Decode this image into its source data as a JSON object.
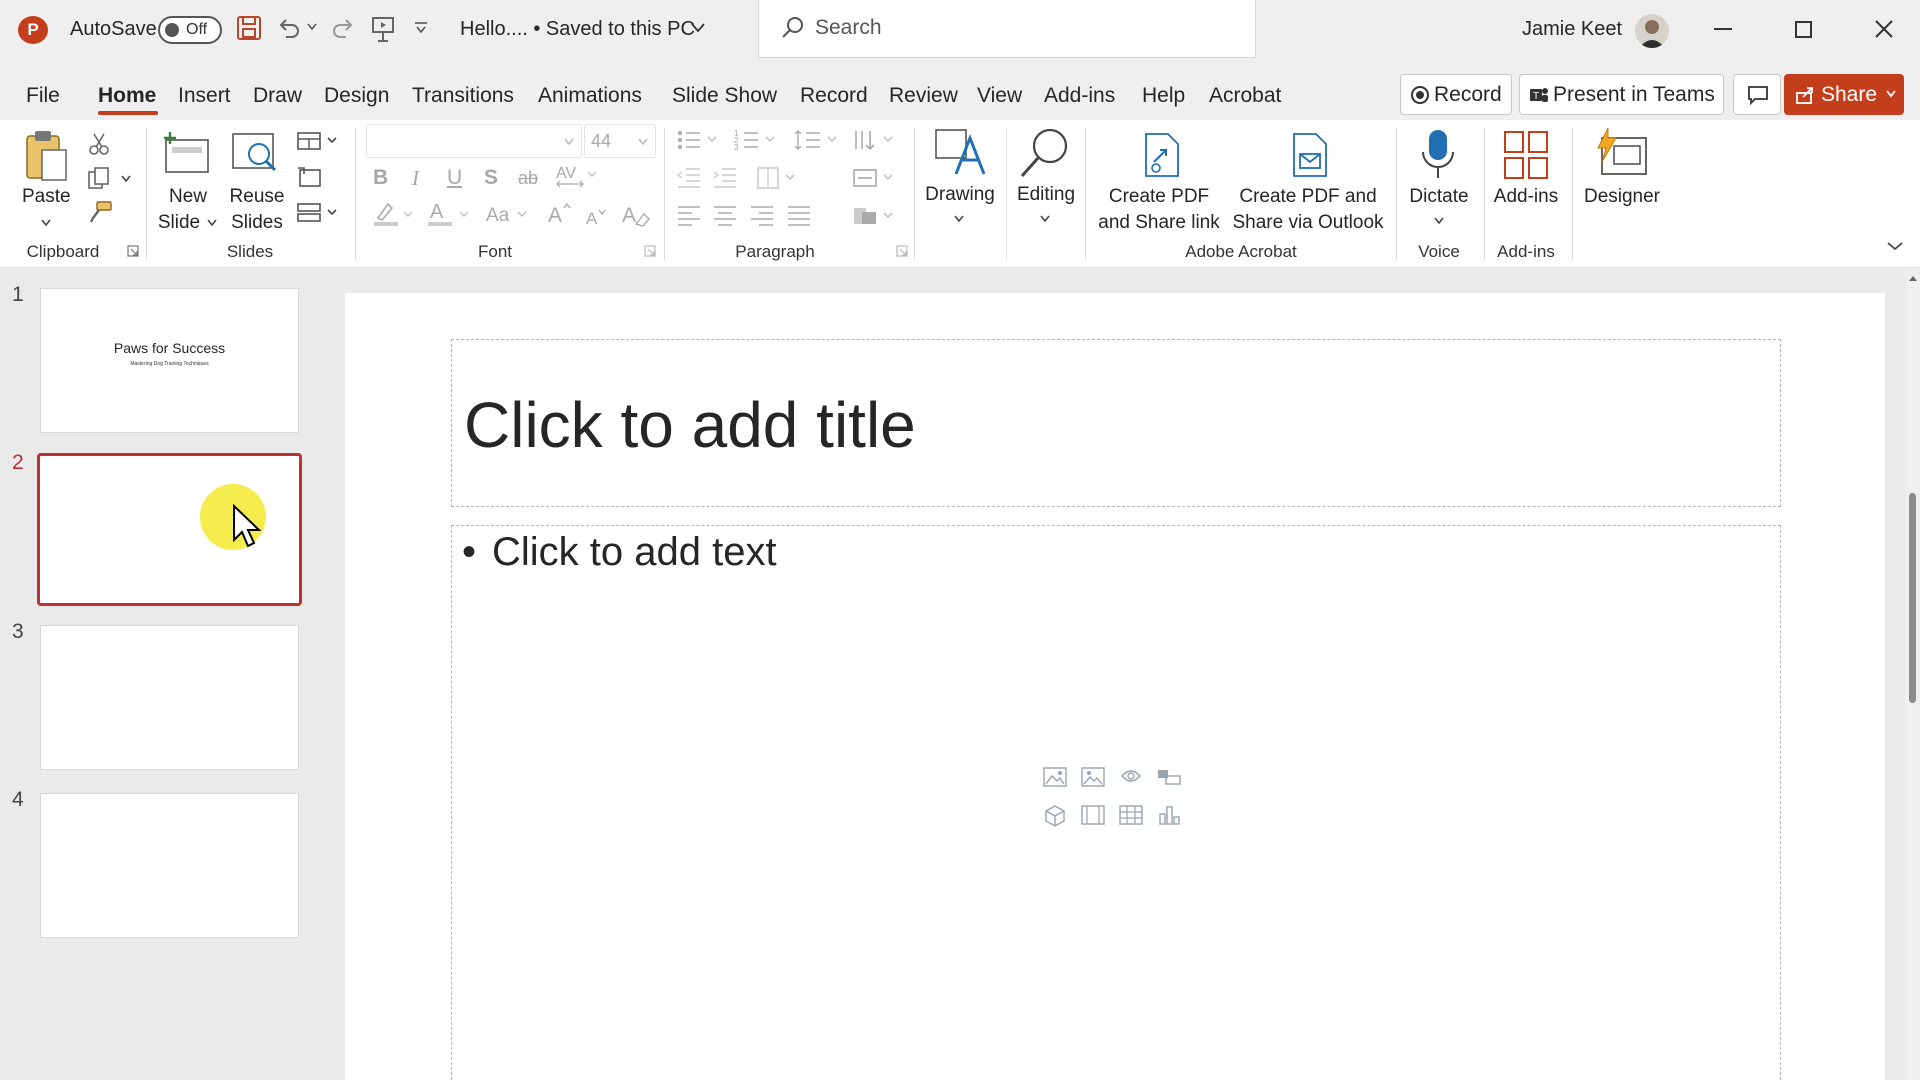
{
  "titlebar": {
    "app_logo": "P",
    "autosave_label": "AutoSave",
    "autosave_state": "Off",
    "doc_title": "Hello.... • Saved to this PC",
    "search_placeholder": "Search",
    "user_name": "Jamie Keet"
  },
  "menu": {
    "tabs": [
      "File",
      "Home",
      "Insert",
      "Draw",
      "Design",
      "Transitions",
      "Animations",
      "Slide Show",
      "Record",
      "Review",
      "View",
      "Add-ins",
      "Help",
      "Acrobat"
    ],
    "active_tab": "Home",
    "record_button": "Record",
    "present_teams_button": "Present in Teams",
    "share_button": "Share"
  },
  "ribbon": {
    "clipboard": {
      "paste": "Paste",
      "group": "Clipboard"
    },
    "slides": {
      "new_slide_1": "New",
      "new_slide_2": "Slide",
      "reuse_1": "Reuse",
      "reuse_2": "Slides",
      "group": "Slides"
    },
    "font": {
      "size": "44",
      "group": "Font"
    },
    "paragraph": {
      "group": "Paragraph"
    },
    "drawing": "Drawing",
    "editing": "Editing",
    "acrobat": {
      "create_share_link_1": "Create PDF",
      "create_share_link_2": "and Share link",
      "create_outlook_1": "Create PDF and",
      "create_outlook_2": "Share via Outlook",
      "group": "Adobe Acrobat"
    },
    "voice": {
      "dictate": "Dictate",
      "group": "Voice"
    },
    "addins": {
      "addins": "Add-ins",
      "group": "Add-ins"
    },
    "designer": "Designer"
  },
  "thumbnails": [
    {
      "number": "1",
      "title": "Paws for Success",
      "subtitle": "Mastering Dog Training Techniques"
    },
    {
      "number": "2",
      "selected": true
    },
    {
      "number": "3"
    },
    {
      "number": "4"
    }
  ],
  "slide": {
    "title_placeholder": "Click to add title",
    "body_placeholder": "Click to add text"
  },
  "colors": {
    "accent": "#c43e1c",
    "selection": "#b83333",
    "cursor_highlight": "#f4ea3a"
  }
}
